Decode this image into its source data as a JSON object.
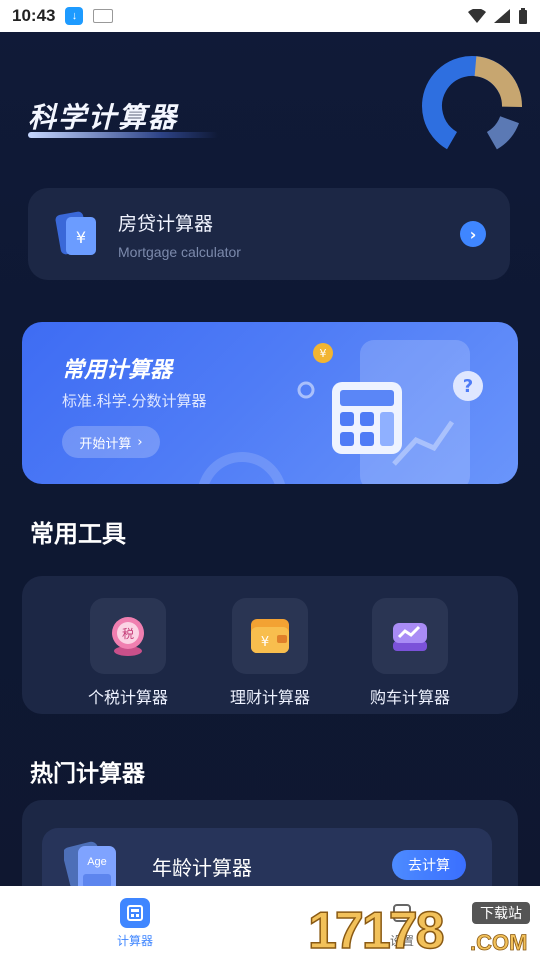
{
  "status_bar": {
    "time": "10:43"
  },
  "app_title": "科学计算器",
  "mortgage": {
    "title": "房贷计算器",
    "subtitle": "Mortgage calculator"
  },
  "banner": {
    "title": "常用计算器",
    "subtitle": "标准.科学.分数计算器",
    "button": "开始计算"
  },
  "tools_section": {
    "title": "常用工具"
  },
  "tools": [
    {
      "label": "个税计算器",
      "icon": "tax-icon"
    },
    {
      "label": "理财计算器",
      "icon": "wallet-icon"
    },
    {
      "label": "购车计算器",
      "icon": "car-icon"
    }
  ],
  "hot_section": {
    "title": "热门计算器"
  },
  "hot_items": [
    {
      "label": "年龄计算器",
      "button": "去计算",
      "icon_text": "Age"
    }
  ],
  "bottom_nav": {
    "items": [
      {
        "label": "计算器"
      },
      {
        "label": "设置"
      }
    ]
  },
  "watermark": {
    "text": "17178",
    "badge": "下载站",
    "domain": ".COM"
  },
  "colors": {
    "accent": "#3f86ff",
    "background": "#0f1832",
    "card": "#1c2745"
  }
}
